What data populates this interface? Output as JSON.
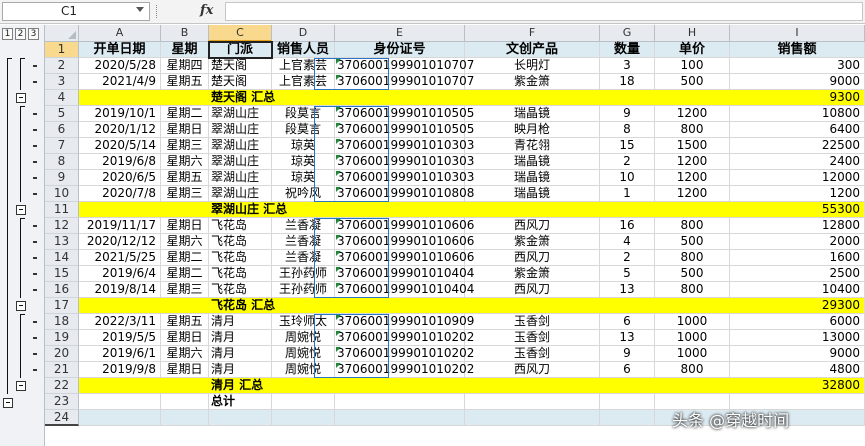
{
  "formula_bar": {
    "name_box": "C1",
    "fx_label": "fx",
    "formula": ""
  },
  "outline_levels": [
    "1",
    "2",
    "3"
  ],
  "columns": [
    "A",
    "B",
    "C",
    "D",
    "E",
    "F",
    "G",
    "H",
    "I"
  ],
  "header_row": [
    "开单日期",
    "星期",
    "门派",
    "销售人员",
    "身份证号",
    "文创产品",
    "数量",
    "单价",
    "销售额"
  ],
  "rows": [
    {
      "n": "2",
      "cells": [
        "2020/5/28",
        "星期四",
        "楚天阁",
        "上官素芸",
        "370600199901010707",
        "长明灯",
        "3",
        "100",
        "300"
      ]
    },
    {
      "n": "3",
      "cells": [
        "2021/4/9",
        "星期五",
        "楚天阁",
        "上官素芸",
        "370600199901010707",
        "紫金箫",
        "18",
        "500",
        "9000"
      ]
    },
    {
      "n": "4",
      "subtotal": true,
      "label": "楚天阁 汇总",
      "total": "9300"
    },
    {
      "n": "5",
      "cells": [
        "2019/10/1",
        "星期二",
        "翠湖山庄",
        "段莫言",
        "370600199901010505",
        "瑞晶镜",
        "9",
        "1200",
        "10800"
      ]
    },
    {
      "n": "6",
      "cells": [
        "2020/1/12",
        "星期日",
        "翠湖山庄",
        "段莫言",
        "370600199901010505",
        "映月枪",
        "8",
        "800",
        "6400"
      ]
    },
    {
      "n": "7",
      "cells": [
        "2020/5/14",
        "星期三",
        "翠湖山庄",
        "琼英",
        "370600199901010303",
        "青花翎",
        "15",
        "1500",
        "22500"
      ]
    },
    {
      "n": "8",
      "cells": [
        "2019/6/8",
        "星期六",
        "翠湖山庄",
        "琼英",
        "370600199901010303",
        "瑞晶镜",
        "2",
        "1200",
        "2400"
      ]
    },
    {
      "n": "9",
      "cells": [
        "2020/6/5",
        "星期五",
        "翠湖山庄",
        "琼英",
        "370600199901010303",
        "瑞晶镜",
        "10",
        "1200",
        "12000"
      ]
    },
    {
      "n": "10",
      "cells": [
        "2020/7/8",
        "星期三",
        "翠湖山庄",
        "祝吟风",
        "370600199901010808",
        "瑞晶镜",
        "1",
        "1200",
        "1200"
      ]
    },
    {
      "n": "11",
      "subtotal": true,
      "label": "翠湖山庄 汇总",
      "total": "55300"
    },
    {
      "n": "12",
      "cells": [
        "2019/11/17",
        "星期日",
        "飞花岛",
        "兰香凝",
        "370600199901010606",
        "西风刀",
        "16",
        "800",
        "12800"
      ]
    },
    {
      "n": "13",
      "cells": [
        "2020/12/12",
        "星期六",
        "飞花岛",
        "兰香凝",
        "370600199901010606",
        "紫金箫",
        "4",
        "500",
        "2000"
      ]
    },
    {
      "n": "14",
      "cells": [
        "2021/5/25",
        "星期二",
        "飞花岛",
        "兰香凝",
        "370600199901010606",
        "西风刀",
        "2",
        "800",
        "1600"
      ]
    },
    {
      "n": "15",
      "cells": [
        "2019/6/4",
        "星期二",
        "飞花岛",
        "王孙药师",
        "370600199901010404",
        "紫金箫",
        "5",
        "500",
        "2500"
      ]
    },
    {
      "n": "16",
      "cells": [
        "2019/8/14",
        "星期三",
        "飞花岛",
        "王孙药师",
        "370600199901010404",
        "西风刀",
        "13",
        "800",
        "10400"
      ]
    },
    {
      "n": "17",
      "subtotal": true,
      "label": "飞花岛 汇总",
      "total": "29300"
    },
    {
      "n": "18",
      "cells": [
        "2022/3/11",
        "星期五",
        "清月",
        "玉玲师太",
        "370600199901010909",
        "玉香剑",
        "6",
        "1000",
        "6000"
      ]
    },
    {
      "n": "19",
      "cells": [
        "2019/5/5",
        "星期日",
        "清月",
        "周婉悦",
        "370600199901010202",
        "玉香剑",
        "13",
        "1000",
        "13000"
      ]
    },
    {
      "n": "20",
      "cells": [
        "2019/6/1",
        "星期六",
        "清月",
        "周婉悦",
        "370600199901010202",
        "玉香剑",
        "9",
        "1000",
        "9000"
      ]
    },
    {
      "n": "21",
      "cells": [
        "2019/9/8",
        "星期日",
        "清月",
        "周婉悦",
        "370600199901010202",
        "西风刀",
        "6",
        "800",
        "4800"
      ]
    },
    {
      "n": "22",
      "subtotal": true,
      "label": "清月 汇总",
      "total": "32800"
    },
    {
      "n": "23",
      "grand": true,
      "label": "总计"
    },
    {
      "n": "24",
      "empty": true
    }
  ],
  "header_row_number": "1",
  "watermark": "头条 @穿越时间",
  "colors": {
    "subtotal_fill": "#ffff00",
    "header_fill": "#dcebf2",
    "selected_header": "#f9d98e",
    "box_border": "#2c73c4"
  }
}
